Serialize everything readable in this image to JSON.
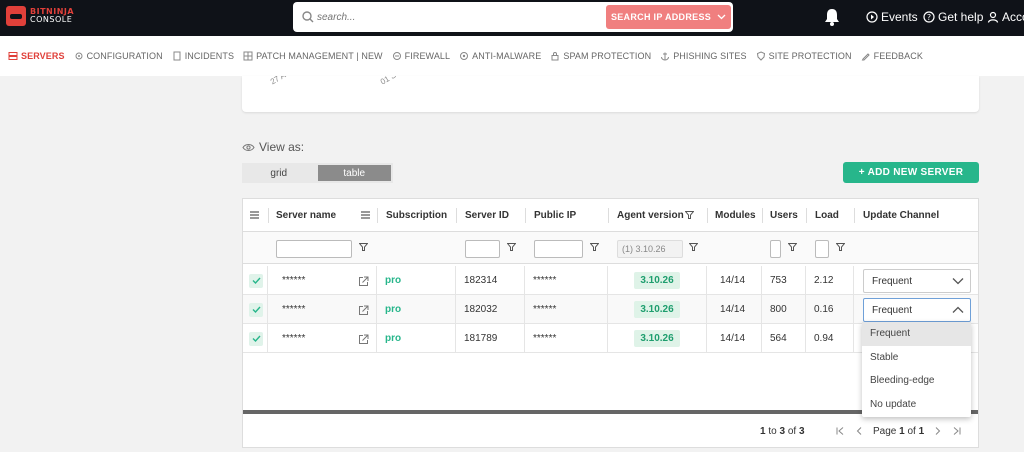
{
  "app": {
    "brand_top": "BITNINJA",
    "brand_bottom": "CONSOLE"
  },
  "search": {
    "placeholder": "search...",
    "button_label": "SEARCH IP ADDRESS"
  },
  "topnav": {
    "events": "Events",
    "help": "Get help",
    "account": "Acco"
  },
  "nav": [
    {
      "label": "SERVERS",
      "icon": "server-icon"
    },
    {
      "label": "CONFIGURATION",
      "icon": "gear-icon"
    },
    {
      "label": "INCIDENTS",
      "icon": "document-icon"
    },
    {
      "label": "PATCH MANAGEMENT | NEW",
      "icon": "grid-icon"
    },
    {
      "label": "FIREWALL",
      "icon": "firewall-icon"
    },
    {
      "label": "ANTI-MALWARE",
      "icon": "bug-icon"
    },
    {
      "label": "SPAM PROTECTION",
      "icon": "lock-icon"
    },
    {
      "label": "PHISHING SITES",
      "icon": "anchor-icon"
    },
    {
      "label": "SITE PROTECTION",
      "icon": "shield-icon"
    },
    {
      "label": "FEEDBACK",
      "icon": "pencil-icon"
    }
  ],
  "chart_ticks": [
    "27 A",
    "01 S"
  ],
  "view": {
    "label": "View as:",
    "options": [
      "grid",
      "table"
    ],
    "selected": "table"
  },
  "add_server": "+ ADD NEW SERVER",
  "table": {
    "columns": [
      "Server name",
      "Subscription",
      "Server ID",
      "Public IP",
      "Agent version",
      "Modules",
      "Users",
      "Load",
      "Update Channel"
    ],
    "agent_filter_placeholder": "(1) 3.10.26",
    "rows": [
      {
        "name": "******",
        "subscription": "pro",
        "server_id": "182314",
        "ip": "******",
        "version": "3.10.26",
        "modules": "14/14",
        "users": "753",
        "load": "2.12",
        "channel": "Frequent"
      },
      {
        "name": "******",
        "subscription": "pro",
        "server_id": "182032",
        "ip": "******",
        "version": "3.10.26",
        "modules": "14/14",
        "users": "800",
        "load": "0.16",
        "channel": "Frequent"
      },
      {
        "name": "******",
        "subscription": "pro",
        "server_id": "181789",
        "ip": "******",
        "version": "3.10.26",
        "modules": "14/14",
        "users": "564",
        "load": "0.94",
        "channel": ""
      }
    ],
    "channel_options": [
      "Frequent",
      "Stable",
      "Bleeding-edge",
      "No update"
    ]
  },
  "pager": {
    "from": "1",
    "to_word": "to",
    "to": "3",
    "of_word": "of",
    "total": "3",
    "page_word": "Page",
    "page": "1",
    "pages": "1"
  },
  "colors": {
    "accent": "#e0403a",
    "green": "#27b68b"
  }
}
